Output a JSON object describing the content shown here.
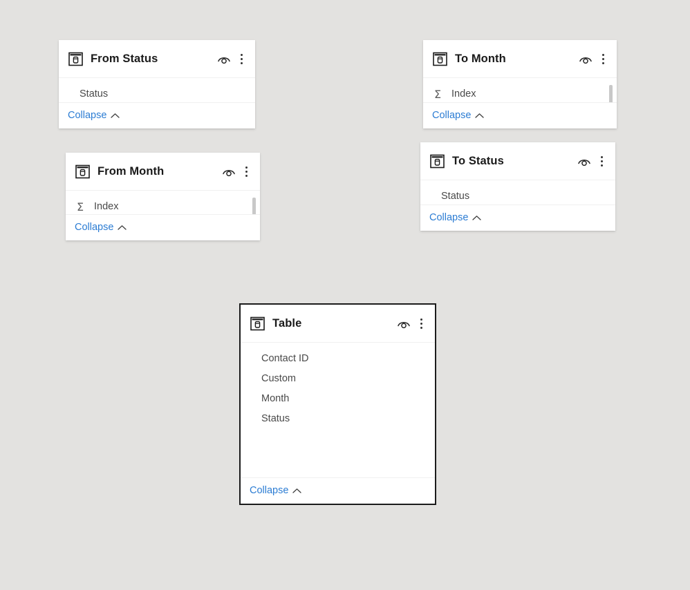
{
  "background_color": "#e3e2e0",
  "theme": {
    "card_background": "#ffffff",
    "link_color": "#2b7cd3",
    "title_color": "#1a1a1a",
    "field_color": "#494949",
    "selected_border_color": "#1b1b1b"
  },
  "icons": {
    "table": "table-icon",
    "hide": "eye-hide-icon",
    "more": "kebab-menu-icon",
    "chevron_up": "chevron-up-icon",
    "sigma": "Σ"
  },
  "cards": [
    {
      "id": "from-status",
      "title": "From Status",
      "selected": false,
      "scrollbar": false,
      "collapse_label": "Collapse",
      "fields": [
        {
          "label": "Status",
          "aggregate": false
        }
      ]
    },
    {
      "id": "to-month",
      "title": "To Month",
      "selected": false,
      "scrollbar": true,
      "collapse_label": "Collapse",
      "fields": [
        {
          "label": "Index",
          "aggregate": true
        }
      ]
    },
    {
      "id": "from-month",
      "title": "From Month",
      "selected": false,
      "scrollbar": true,
      "collapse_label": "Collapse",
      "fields": [
        {
          "label": "Index",
          "aggregate": true
        }
      ]
    },
    {
      "id": "to-status",
      "title": "To Status",
      "selected": false,
      "scrollbar": false,
      "collapse_label": "Collapse",
      "fields": [
        {
          "label": "Status",
          "aggregate": false
        }
      ]
    },
    {
      "id": "table",
      "title": "Table",
      "selected": true,
      "scrollbar": false,
      "collapse_label": "Collapse",
      "fields": [
        {
          "label": "Contact ID",
          "aggregate": false
        },
        {
          "label": "Custom",
          "aggregate": false
        },
        {
          "label": "Month",
          "aggregate": false
        },
        {
          "label": "Status",
          "aggregate": false
        }
      ]
    }
  ]
}
